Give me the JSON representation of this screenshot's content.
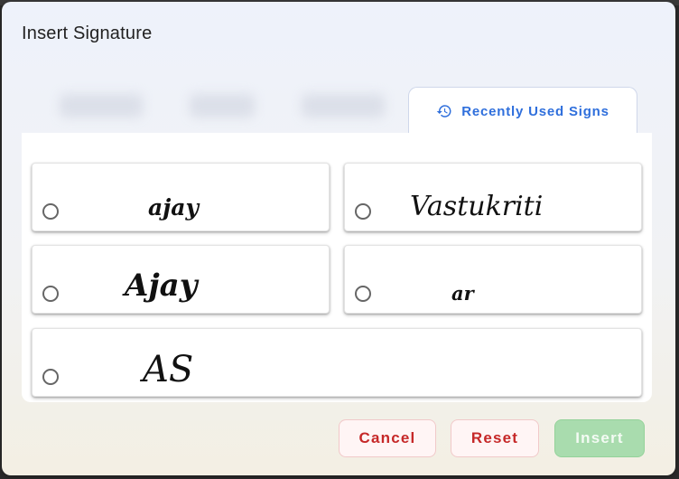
{
  "dialog": {
    "title": "Insert Signature",
    "tabs": {
      "active_label": "Recently Used Signs",
      "active_icon": "history-icon"
    },
    "signatures": [
      {
        "text": "ajay",
        "selected": false
      },
      {
        "text": "Vastukriti",
        "selected": false
      },
      {
        "text": "Ajay",
        "selected": false
      },
      {
        "text": "ar",
        "selected": false
      },
      {
        "text": "AS",
        "selected": false
      }
    ],
    "buttons": {
      "cancel_label": "Cancel",
      "reset_label": "Reset",
      "insert_label": "Insert"
    },
    "colors": {
      "accent": "#2f6fdc",
      "danger": "#c62828",
      "insert_disabled": "#a9dcae"
    }
  }
}
